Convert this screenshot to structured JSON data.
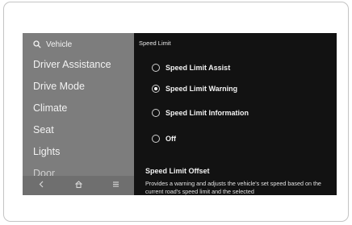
{
  "sidebar": {
    "search_label": "Vehicle",
    "items": [
      {
        "label": "Driver Assistance"
      },
      {
        "label": "Drive Mode"
      },
      {
        "label": "Climate"
      },
      {
        "label": "Seat"
      },
      {
        "label": "Lights"
      },
      {
        "label": "Door"
      }
    ],
    "bottom_icons": [
      "back-icon",
      "home-icon",
      "menu-icon"
    ]
  },
  "panel": {
    "title": "Speed Limit",
    "options": [
      {
        "label": "Speed Limit Assist",
        "selected": false
      },
      {
        "label": "Speed Limit Warning",
        "selected": true
      },
      {
        "label": "Speed Limit Information",
        "selected": false
      },
      {
        "label": "Off",
        "selected": false
      }
    ],
    "section": {
      "title": "Speed Limit Offset",
      "description": "Provides a warning and adjusts the vehicle's set speed based on the current road's speed limit and the selected"
    }
  },
  "colors": {
    "sidebar_bg": "#7d7d7d",
    "panel_bg": "#121212",
    "text": "#f2f2f2"
  }
}
